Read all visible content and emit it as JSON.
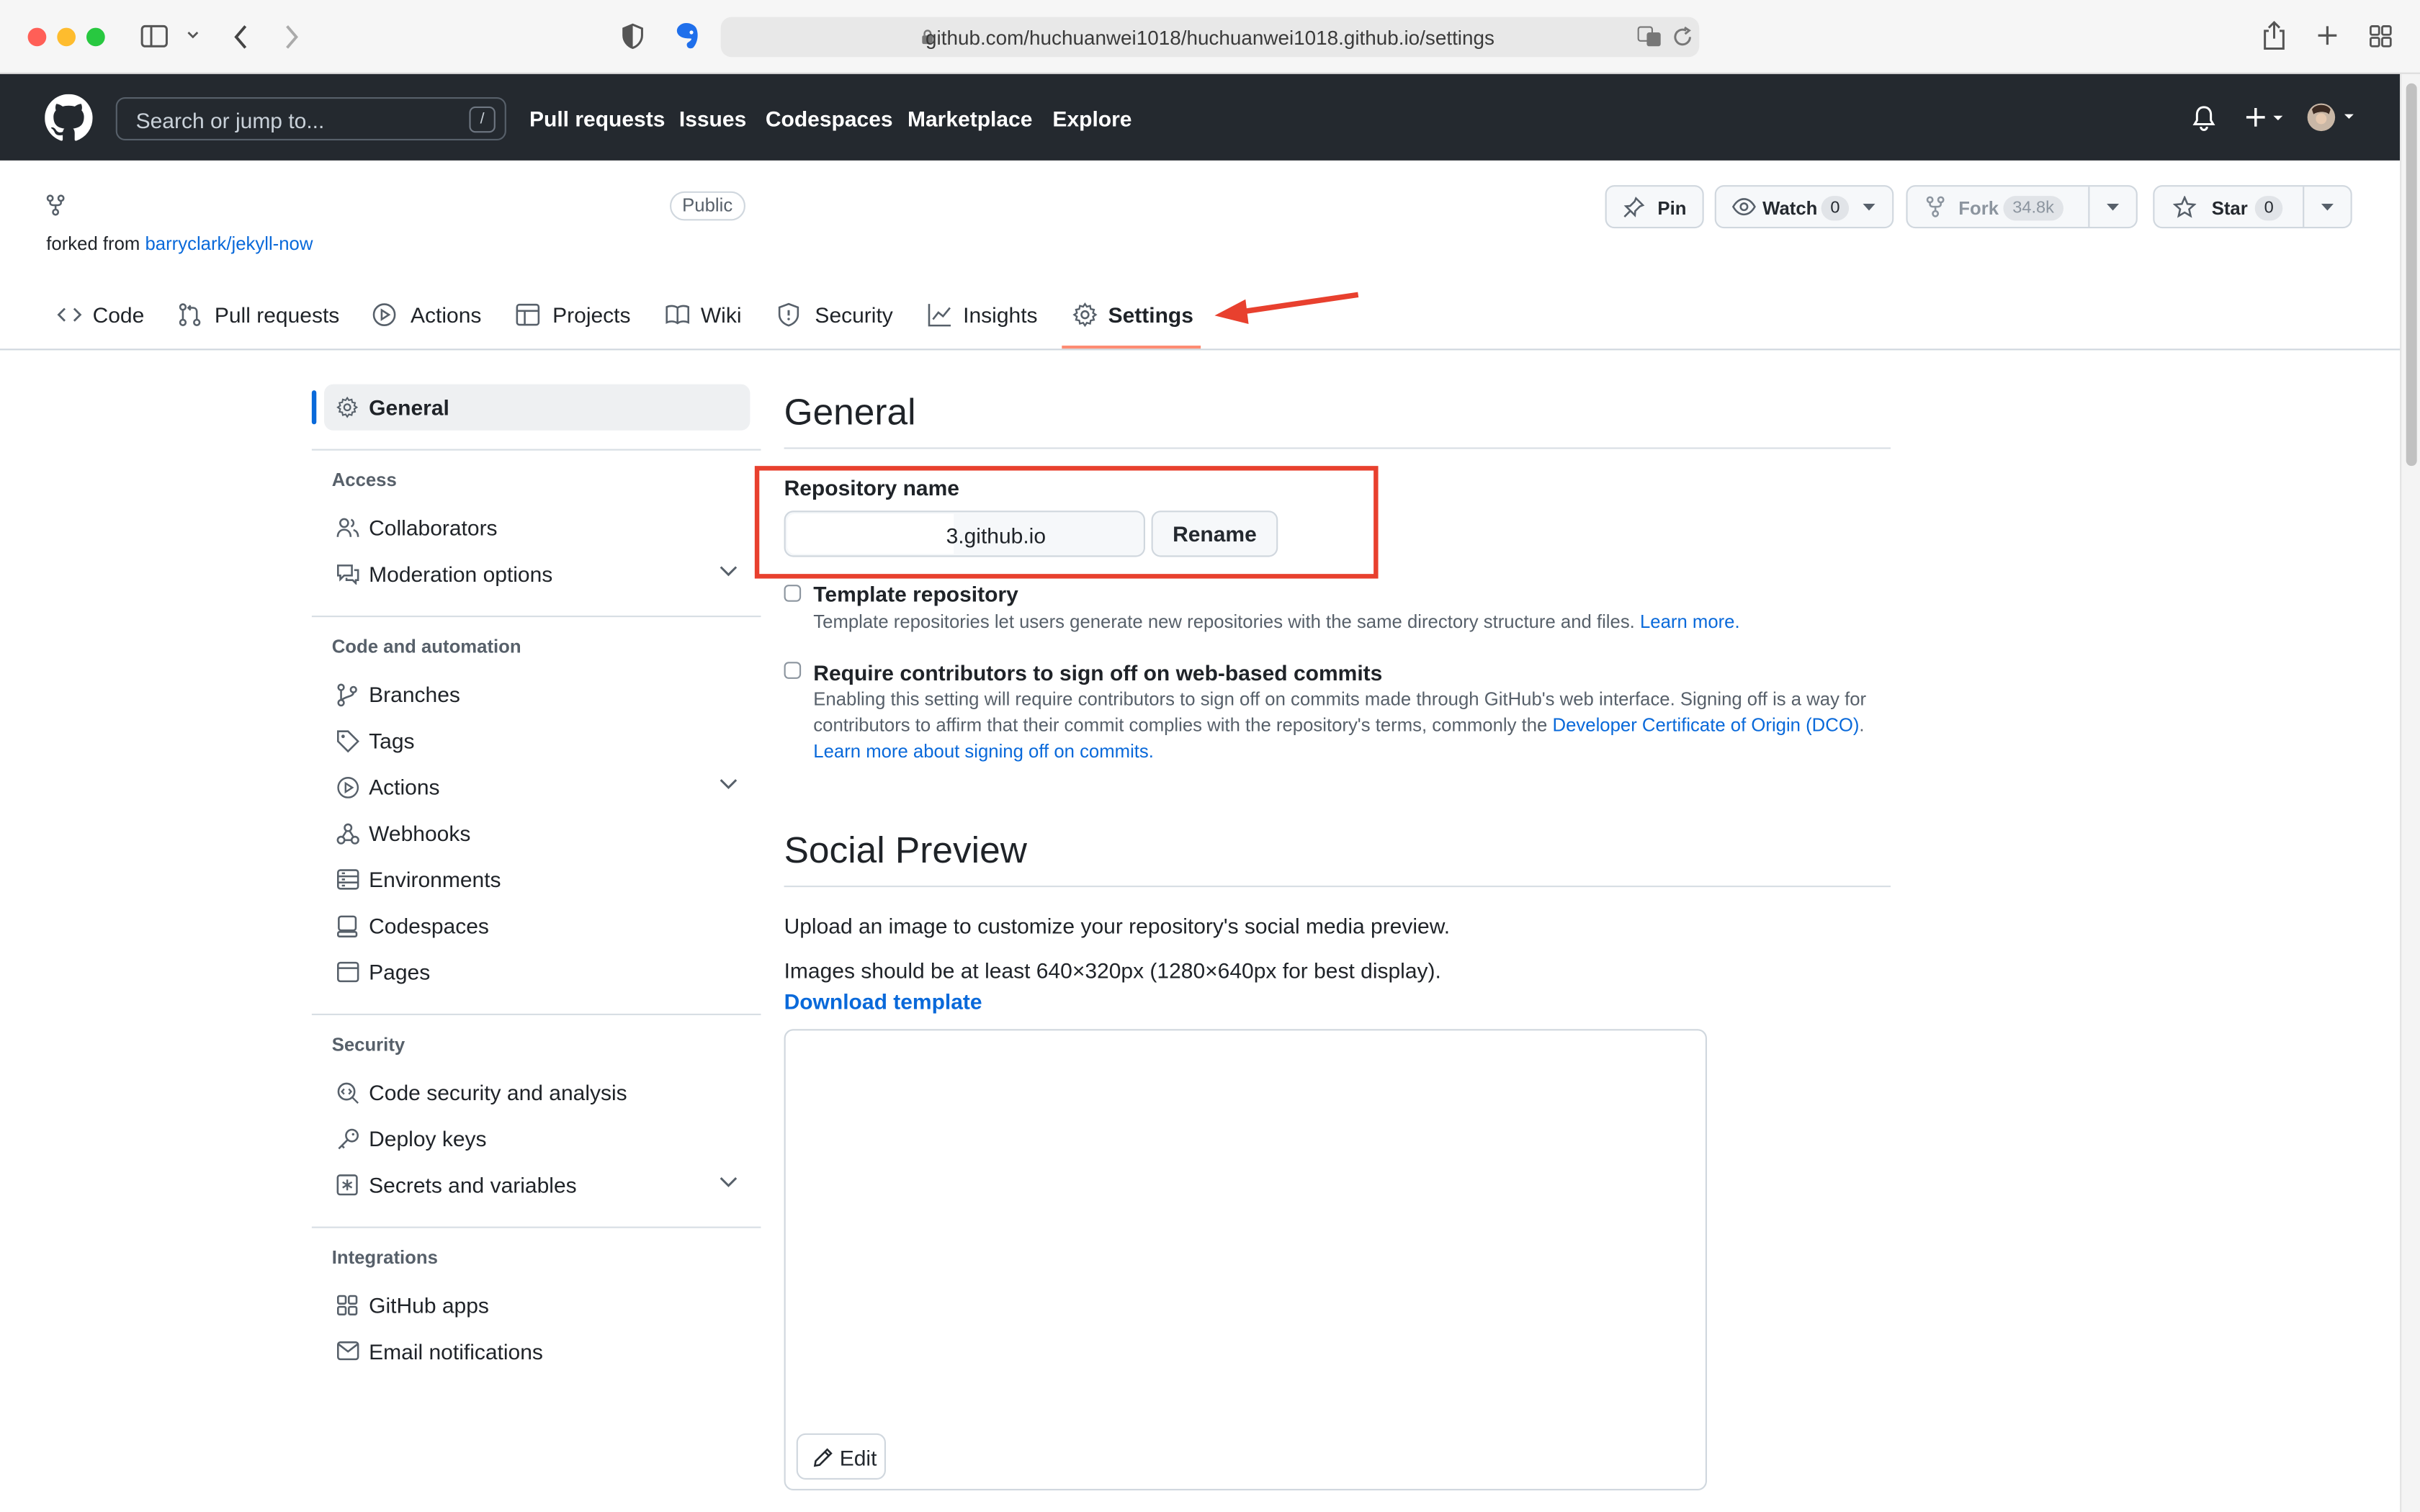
{
  "browser": {
    "url": "github.com/huchuanwei1018/huchuanwei1018.github.io/settings"
  },
  "header": {
    "search_placeholder": "Search or jump to...",
    "search_shortcut": "/",
    "nav": [
      "Pull requests",
      "Issues",
      "Codespaces",
      "Marketplace",
      "Explore"
    ]
  },
  "repo": {
    "visibility": "Public",
    "forked_prefix": "forked from",
    "forked_source": "barryclark/jekyll-now",
    "pin_label": "Pin",
    "watch_label": "Watch",
    "watch_count": "0",
    "fork_label": "Fork",
    "fork_count": "34.8k",
    "star_label": "Star",
    "star_count": "0"
  },
  "tabs": [
    "Code",
    "Pull requests",
    "Actions",
    "Projects",
    "Wiki",
    "Security",
    "Insights",
    "Settings"
  ],
  "sidebar": {
    "general": "General",
    "sections": [
      {
        "heading": "Access",
        "items": [
          "Collaborators",
          "Moderation options"
        ]
      },
      {
        "heading": "Code and automation",
        "items": [
          "Branches",
          "Tags",
          "Actions",
          "Webhooks",
          "Environments",
          "Codespaces",
          "Pages"
        ]
      },
      {
        "heading": "Security",
        "items": [
          "Code security and analysis",
          "Deploy keys",
          "Secrets and variables"
        ]
      },
      {
        "heading": "Integrations",
        "items": [
          "GitHub apps",
          "Email notifications"
        ]
      }
    ]
  },
  "main": {
    "title": "General",
    "repo_name_label": "Repository name",
    "repo_name_value": "3.github.io",
    "rename_label": "Rename",
    "template": {
      "title": "Template repository",
      "desc": "Template repositories let users generate new repositories with the same directory structure and files.",
      "link": "Learn more."
    },
    "signoff": {
      "title": "Require contributors to sign off on web-based commits",
      "line1": "Enabling this setting will require contributors to sign off on commits made through GitHub's web interface. Signing off is a way for",
      "line2_prefix": "contributors to affirm that their commit complies with the repository's terms, commonly the",
      "line2_link": "Developer Certificate of Origin (DCO)",
      "line2_suffix": ".",
      "line3_link": "Learn more about signing off on commits."
    },
    "social": {
      "title": "Social Preview",
      "line1": "Upload an image to customize your repository's social media preview.",
      "line2": "Images should be at least 640×320px (1280×640px for best display).",
      "download": "Download template",
      "edit": "Edit"
    }
  },
  "colors": {
    "annotation_red": "#e8402e",
    "link_blue": "#0969da",
    "header_bg": "#24292f",
    "tab_underline": "#fd8c73"
  }
}
